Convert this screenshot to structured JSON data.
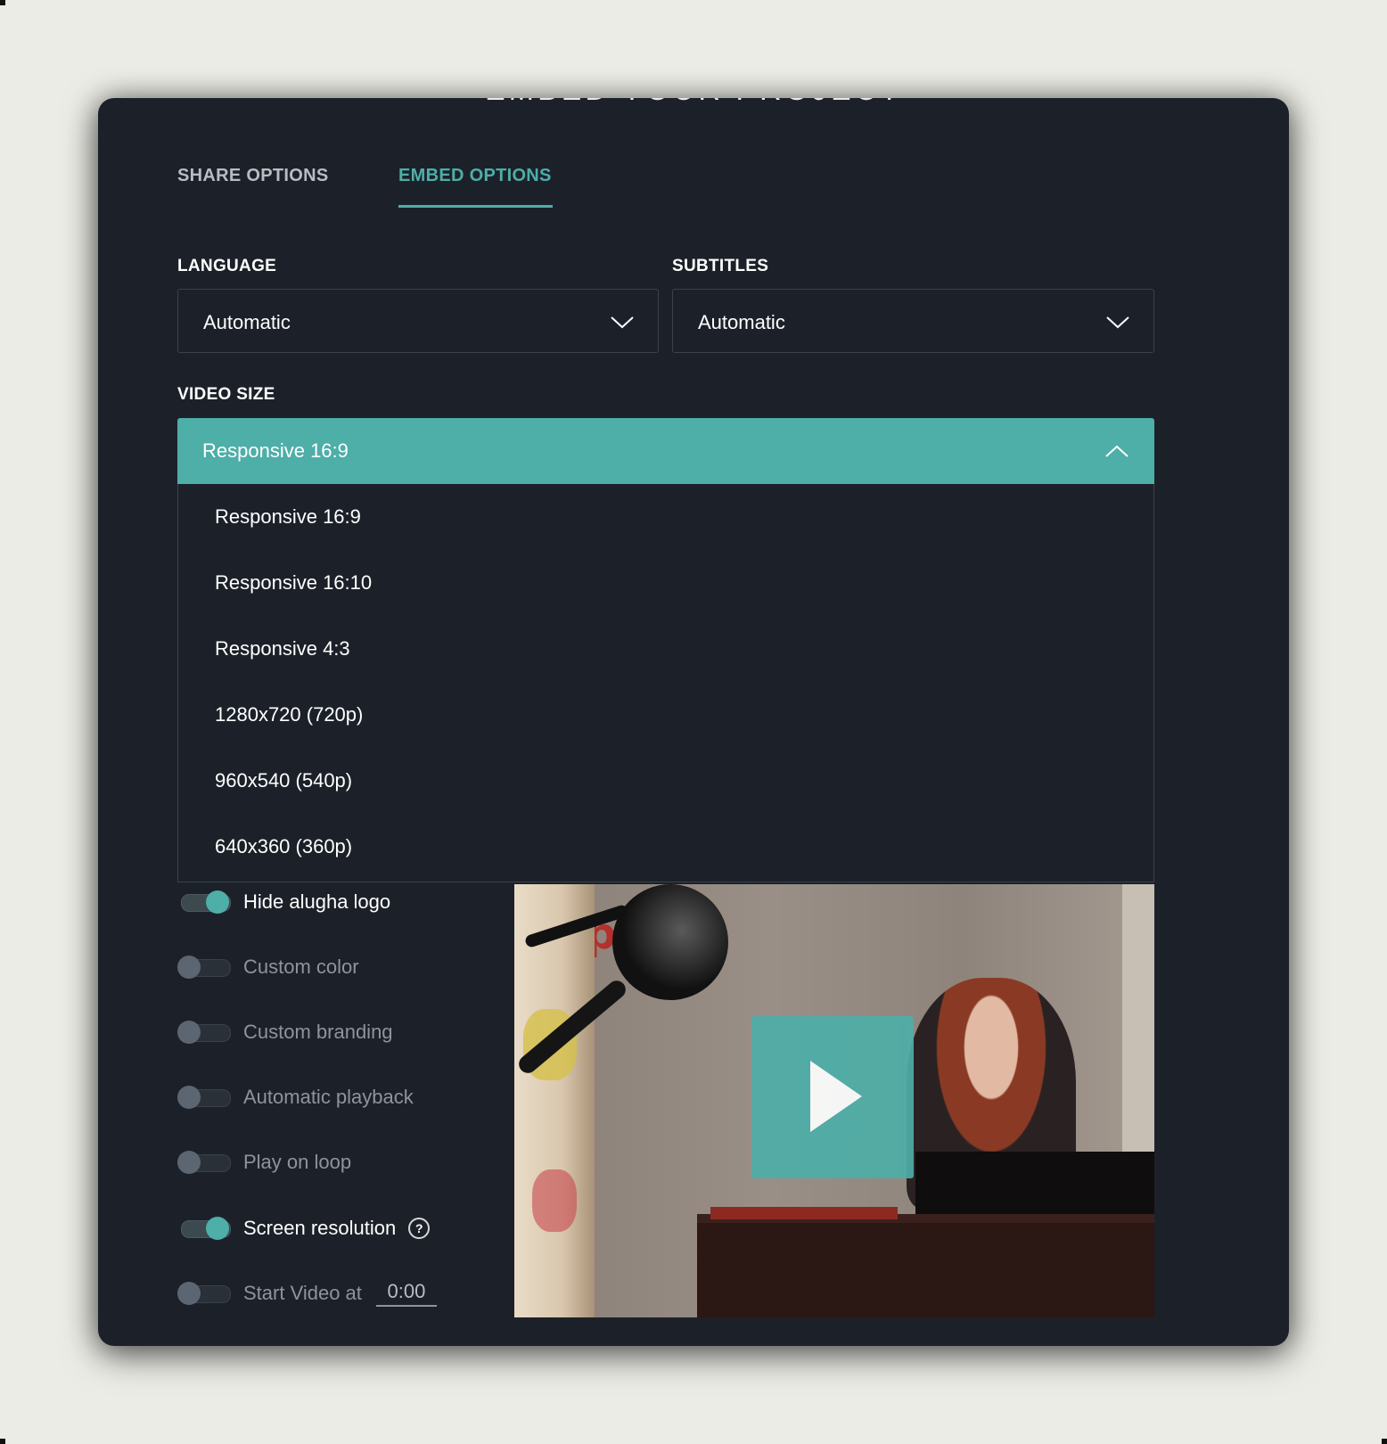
{
  "modal": {
    "title": "EMBED YOUR PROJECT",
    "tabs": [
      {
        "label": "SHARE OPTIONS",
        "active": false
      },
      {
        "label": "EMBED OPTIONS",
        "active": true
      }
    ]
  },
  "language": {
    "label": "LANGUAGE",
    "value": "Automatic"
  },
  "subtitles": {
    "label": "SUBTITLES",
    "value": "Automatic"
  },
  "video_size": {
    "label": "VIDEO SIZE",
    "value": "Responsive 16:9",
    "options": [
      "Responsive 16:9",
      "Responsive 16:10",
      "Responsive 4:3",
      "1280x720 (720p)",
      "960x540 (540p)",
      "640x360 (360p)"
    ]
  },
  "toggles": [
    {
      "label": "Hide alugha logo",
      "on": true
    },
    {
      "label": "Custom color",
      "on": false
    },
    {
      "label": "Custom branding",
      "on": false
    },
    {
      "label": "Automatic playback",
      "on": false
    },
    {
      "label": "Play on loop",
      "on": false
    },
    {
      "label": "Screen resolution",
      "on": true,
      "help": "?"
    },
    {
      "label": "Start Video at",
      "on": false,
      "time": "0:00"
    }
  ],
  "preview": {
    "wall_text": "ppy"
  },
  "colors": {
    "accent": "#4eaea8",
    "panel": "#1c2129",
    "page": "#ecece6"
  }
}
